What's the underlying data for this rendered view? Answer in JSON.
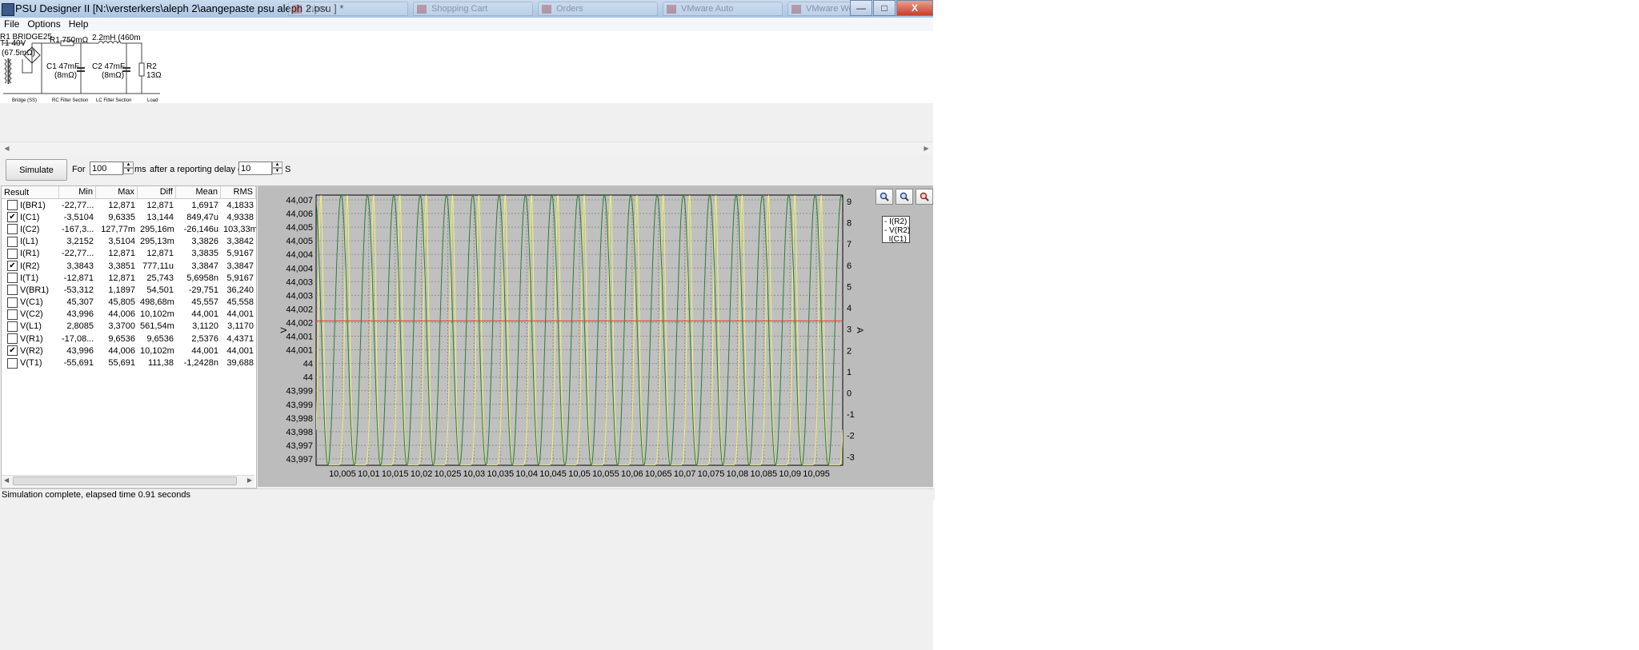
{
  "window": {
    "title": "PSU Designer II  [N:\\versterkers\\aleph 2\\aangepaste psu aleph 2.psu ] *",
    "background_tabs": [
      "Inbox",
      "Shopping Cart",
      "Orders",
      "VMware Auto",
      "VMware Work"
    ],
    "minimize": "—",
    "maximize": "□",
    "close": "X"
  },
  "menu": {
    "file": "File",
    "options": "Options",
    "help": "Help"
  },
  "schematic": {
    "t1_label": "T1 40V",
    "t1_resistance": "(67.5mΩ)",
    "bridge_label": "R1 BRIDGE25",
    "r1_label": "R1 750mΩ",
    "l1_label": "2.2mH (460m",
    "c1_label": "C1 47mF",
    "c1_esr": "(8mΩ)",
    "c2_label": "C2 47mF",
    "c2_esr": "(8mΩ)",
    "r2_label": "R2",
    "r2_value": "13Ω",
    "section_bridge": "Bridge (SS)",
    "section_rc": "RC Filter Section",
    "section_lc": "LC Filter Section",
    "section_load": "Load"
  },
  "controls": {
    "simulate": "Simulate",
    "for_label": "For",
    "duration": "100",
    "duration_unit": "ms",
    "delay_label": "after a reporting delay of",
    "delay": "10",
    "delay_unit": "S"
  },
  "results": {
    "headers": [
      "Result",
      "Min",
      "Max",
      "Diff",
      "Mean",
      "RMS"
    ],
    "rows": [
      {
        "name": "I(BR1)",
        "checked": false,
        "min": "-22,77...",
        "max": "12,871",
        "diff": "12,871",
        "mean": "1,6917",
        "rms": "4,1833"
      },
      {
        "name": "I(C1)",
        "checked": true,
        "min": "-3,5104",
        "max": "9,6335",
        "diff": "13,144",
        "mean": "849,47u",
        "rms": "4,9338"
      },
      {
        "name": "I(C2)",
        "checked": false,
        "min": "-167,3...",
        "max": "127,77m",
        "diff": "295,16m",
        "mean": "-26,146u",
        "rms": "103,33m"
      },
      {
        "name": "I(L1)",
        "checked": false,
        "min": "3,2152",
        "max": "3,5104",
        "diff": "295,13m",
        "mean": "3,3826",
        "rms": "3,3842"
      },
      {
        "name": "I(R1)",
        "checked": false,
        "min": "-22,77...",
        "max": "12,871",
        "diff": "12,871",
        "mean": "3,3835",
        "rms": "5,9167"
      },
      {
        "name": "I(R2)",
        "checked": true,
        "min": "3,3843",
        "max": "3,3851",
        "diff": "777,11u",
        "mean": "3,3847",
        "rms": "3,3847"
      },
      {
        "name": "I(T1)",
        "checked": false,
        "min": "-12,871",
        "max": "12,871",
        "diff": "25,743",
        "mean": "5,6958n",
        "rms": "5,9167"
      },
      {
        "name": "V(BR1)",
        "checked": false,
        "min": "-53,312",
        "max": "1,1897",
        "diff": "54,501",
        "mean": "-29,751",
        "rms": "36,240"
      },
      {
        "name": "V(C1)",
        "checked": false,
        "min": "45,307",
        "max": "45,805",
        "diff": "498,68m",
        "mean": "45,557",
        "rms": "45,558"
      },
      {
        "name": "V(C2)",
        "checked": false,
        "min": "43,996",
        "max": "44,006",
        "diff": "10,102m",
        "mean": "44,001",
        "rms": "44,001"
      },
      {
        "name": "V(L1)",
        "checked": false,
        "min": "2,8085",
        "max": "3,3700",
        "diff": "561,54m",
        "mean": "3,1120",
        "rms": "3,1170"
      },
      {
        "name": "V(R1)",
        "checked": false,
        "min": "-17,08...",
        "max": "9,6536",
        "diff": "9,6536",
        "mean": "2,5376",
        "rms": "4,4371"
      },
      {
        "name": "V(R2)",
        "checked": true,
        "min": "43,996",
        "max": "44,006",
        "diff": "10,102m",
        "mean": "44,001",
        "rms": "44,001"
      },
      {
        "name": "V(T1)",
        "checked": false,
        "min": "-55,691",
        "max": "55,691",
        "diff": "111,38",
        "mean": "-1,2428n",
        "rms": "39,688"
      }
    ]
  },
  "chart_icons": [
    "zoom-in-icon",
    "zoom-out-icon",
    "zoom-reset-icon"
  ],
  "chart_data": {
    "type": "line",
    "xlabel": "",
    "ylabel_left": "V",
    "ylabel_right": "A",
    "xlim": [
      10.0,
      10.1
    ],
    "x_ticks": [
      "10,005",
      "10,01",
      "10,015",
      "10,02",
      "10,025",
      "10,03",
      "10,035",
      "10,04",
      "10,045",
      "10,05",
      "10,055",
      "10,06",
      "10,065",
      "10,07",
      "10,075",
      "10,08",
      "10,085",
      "10,09",
      "10,095"
    ],
    "y_left_ticks": [
      "44,007",
      "44,006",
      "44,005",
      "44,005",
      "44,004",
      "44,004",
      "44,003",
      "44,003",
      "44,002",
      "44,002",
      "44,001",
      "44,001",
      "44",
      "44",
      "43,999",
      "43,999",
      "43,998",
      "43,998",
      "43,997",
      "43,997"
    ],
    "y_right_ticks": [
      "9",
      "8",
      "7",
      "6",
      "5",
      "4",
      "3",
      "2",
      "1",
      "0",
      "-1",
      "-2",
      "-3"
    ],
    "y_right_lim": [
      -3.4,
      9.3
    ],
    "grid": true,
    "legend_position": "right",
    "legend": [
      "I(R2)",
      "V(R2)",
      "I(C1)"
    ],
    "series": [
      {
        "name": "I(R2)",
        "color": "#ff2a2a",
        "axis": "right",
        "shape": "constant",
        "value": 3.3847
      },
      {
        "name": "V(R2)",
        "color": "#2e7d32",
        "axis": "right",
        "shape": "sine",
        "period": 0.005,
        "phase": 0.0035,
        "min": -3.4,
        "max": 9.3
      },
      {
        "name": "I(C1)",
        "color": "#f3f36a",
        "axis": "right",
        "shape": "pulse",
        "period": 0.005,
        "phase": 0.0009,
        "min": -3.4,
        "max": 9.3
      }
    ]
  },
  "status": "Simulation complete, elapsed time 0.91 seconds"
}
